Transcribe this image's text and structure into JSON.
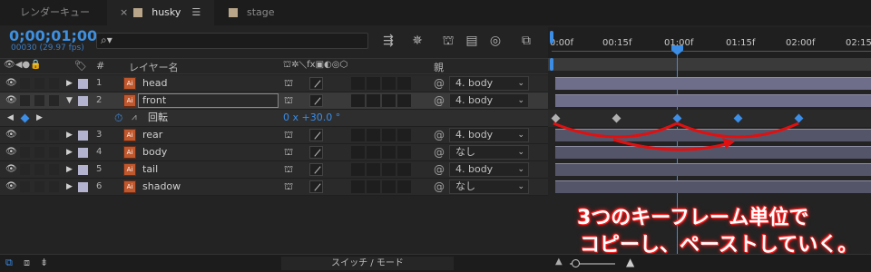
{
  "tabs": {
    "render_queue": "レンダーキュー",
    "husky": "husky",
    "stage": "stage"
  },
  "timecode": {
    "main": "0;00;01;00",
    "sub": "00030 (29.97 fps)"
  },
  "search": {
    "placeholder": ""
  },
  "columns": {
    "num": "#",
    "layer_name": "レイヤー名",
    "parent": "親"
  },
  "ruler": [
    "0:00f",
    "00:15f",
    "01:00f",
    "01:15f",
    "02:00f",
    "02:15"
  ],
  "layers": [
    {
      "num": "1",
      "name": "head",
      "parent": "4. body"
    },
    {
      "num": "2",
      "name": "front",
      "parent": "4. body"
    },
    {
      "num": "3",
      "name": "rear",
      "parent": "4. body"
    },
    {
      "num": "4",
      "name": "body",
      "parent": "なし"
    },
    {
      "num": "5",
      "name": "tail",
      "parent": "4. body"
    },
    {
      "num": "6",
      "name": "shadow",
      "parent": "なし"
    }
  ],
  "property": {
    "name": "回転",
    "value": "0 x +30.0 °"
  },
  "annotation": {
    "line1": "3つのキーフレーム単位で",
    "line2": "コピーし、ペーストしていく。"
  },
  "footer": {
    "toggle_label": "スイッチ / モード"
  },
  "colors": {
    "timecode": "#3d8fe0",
    "keyframe_active": "#3b8de6",
    "annotation_arrow": "#e01010",
    "layer_label": "#b3b3cf"
  }
}
